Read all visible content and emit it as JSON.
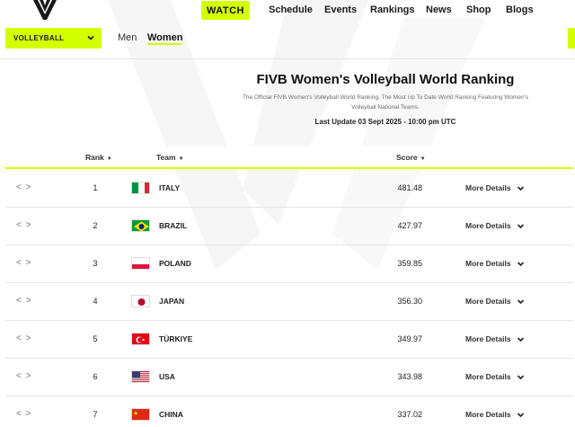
{
  "nav": {
    "watch_label": "WATCH",
    "links": [
      "Schedule",
      "Events",
      "Rankings",
      "News",
      "Shop",
      "Blogs"
    ]
  },
  "subbar": {
    "sport_value": "VOLLEYBALL",
    "tabs": [
      {
        "label": "Men"
      },
      {
        "label": "Women"
      }
    ],
    "active_tab": "Women"
  },
  "header": {
    "title": "FIVB Women's Volleyball World Ranking",
    "description": "The Official FIVB Women's Volleyball World Ranking. The Most Up To Date World Ranking Featuring Women's Volleyball National Teams.",
    "last_update": "Last Update 03 Sept 2025 - 10:00 pm UTC"
  },
  "table": {
    "columns": {
      "rank": "Rank",
      "team": "Team",
      "score": "Score"
    },
    "more_label": "More Details",
    "rows": [
      {
        "rank": "1",
        "team": "ITALY",
        "score": "481.48",
        "flag": "italy"
      },
      {
        "rank": "2",
        "team": "BRAZIL",
        "score": "427.97",
        "flag": "brazil"
      },
      {
        "rank": "3",
        "team": "POLAND",
        "score": "359.85",
        "flag": "poland"
      },
      {
        "rank": "4",
        "team": "JAPAN",
        "score": "356.30",
        "flag": "japan"
      },
      {
        "rank": "5",
        "team": "TÜRKIYE",
        "score": "349.97",
        "flag": "turkiye"
      },
      {
        "rank": "6",
        "team": "USA",
        "score": "343.98",
        "flag": "usa"
      },
      {
        "rank": "7",
        "team": "CHINA",
        "score": "337.02",
        "flag": "china"
      }
    ]
  },
  "colors": {
    "accent": "#d4ff00",
    "divider": "#e4e4e4"
  }
}
